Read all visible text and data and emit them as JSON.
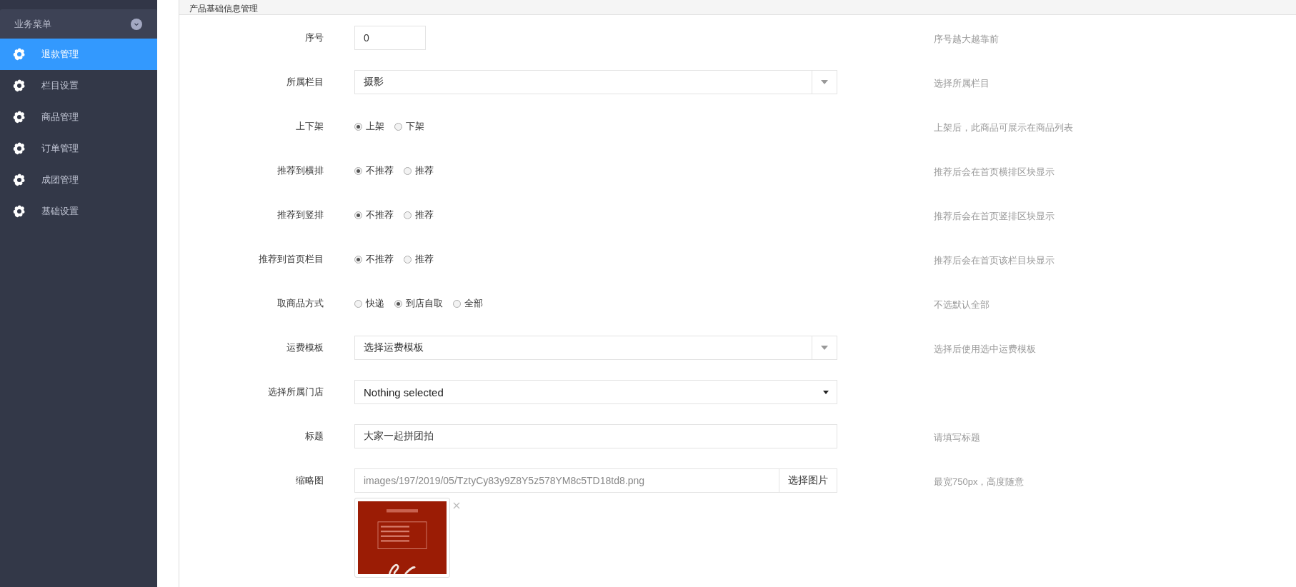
{
  "sidebar": {
    "title": "业务菜单",
    "items": [
      {
        "label": "退款管理",
        "selected": true
      },
      {
        "label": "栏目设置",
        "selected": false
      },
      {
        "label": "商品管理",
        "selected": false
      },
      {
        "label": "订单管理",
        "selected": false
      },
      {
        "label": "成团管理",
        "selected": false
      },
      {
        "label": "基础设置",
        "selected": false
      }
    ]
  },
  "panel": {
    "title": "产品基础信息管理",
    "fields": [
      {
        "kind": "number",
        "label": "序号",
        "value": "0",
        "hint": "序号越大越靠前"
      },
      {
        "kind": "select",
        "label": "所属栏目",
        "value": "摄影",
        "hint": "选择所属栏目"
      },
      {
        "kind": "radio",
        "label": "上下架",
        "options": [
          {
            "label": "上架",
            "selected": true
          },
          {
            "label": "下架",
            "selected": false
          }
        ],
        "hint": "上架后，此商品可展示在商品列表"
      },
      {
        "kind": "radio",
        "label": "推荐到横排",
        "options": [
          {
            "label": "不推荐",
            "selected": true
          },
          {
            "label": "推荐",
            "selected": false
          }
        ],
        "hint": "推荐后会在首页横排区块显示"
      },
      {
        "kind": "radio",
        "label": "推荐到竖排",
        "options": [
          {
            "label": "不推荐",
            "selected": true
          },
          {
            "label": "推荐",
            "selected": false
          }
        ],
        "hint": "推荐后会在首页竖排区块显示"
      },
      {
        "kind": "radio",
        "label": "推荐到首页栏目",
        "options": [
          {
            "label": "不推荐",
            "selected": true
          },
          {
            "label": "推荐",
            "selected": false
          }
        ],
        "hint": "推荐后会在首页该栏目块显示"
      },
      {
        "kind": "radio",
        "label": "取商品方式",
        "options": [
          {
            "label": "快递",
            "selected": false
          },
          {
            "label": "到店自取",
            "selected": true
          },
          {
            "label": "全部",
            "selected": false
          }
        ],
        "hint": "不选默认全部"
      },
      {
        "kind": "select",
        "label": "运费模板",
        "value": "选择运费模板",
        "hint": "选择后使用选中运费模板"
      },
      {
        "kind": "dropdown",
        "label": "选择所属门店",
        "value": "Nothing selected"
      },
      {
        "kind": "text",
        "label": "标题",
        "value": "大家一起拼团拍",
        "hint": "请填写标题"
      },
      {
        "label": "缩略图",
        "value": "images/197/2019/05/TztyCy83y9Z8Y5z578YM8c5TD18td8.png",
        "button": "选择图片",
        "hint": "最宽750px，高度随意"
      }
    ]
  }
}
